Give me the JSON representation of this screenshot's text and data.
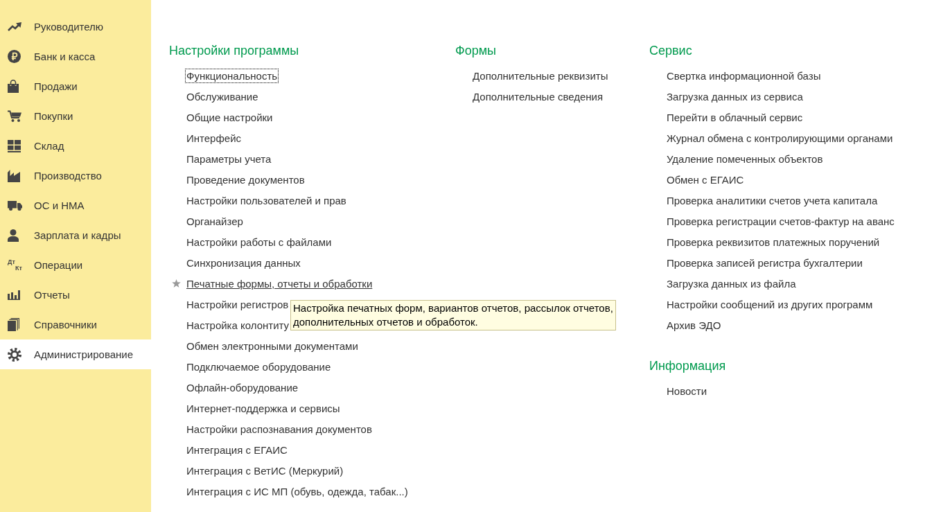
{
  "sidebar": {
    "items": [
      {
        "label": "Руководителю",
        "selected": false
      },
      {
        "label": "Банк и касса",
        "selected": false
      },
      {
        "label": "Продажи",
        "selected": false
      },
      {
        "label": "Покупки",
        "selected": false
      },
      {
        "label": "Склад",
        "selected": false
      },
      {
        "label": "Производство",
        "selected": false
      },
      {
        "label": "ОС и НМА",
        "selected": false
      },
      {
        "label": "Зарплата и кадры",
        "selected": false
      },
      {
        "label": "Операции",
        "selected": false,
        "icon_lines": [
          "Дт",
          "Кт"
        ]
      },
      {
        "label": "Отчеты",
        "selected": false
      },
      {
        "label": "Справочники",
        "selected": false
      },
      {
        "label": "Администрирование",
        "selected": true
      }
    ]
  },
  "columns": [
    {
      "groups": [
        {
          "title": "Настройки программы",
          "items": [
            {
              "label": "Функциональность",
              "focused": true,
              "hovered": false
            },
            {
              "label": "Обслуживание",
              "focused": false,
              "hovered": false
            },
            {
              "label": "Общие настройки",
              "focused": false,
              "hovered": false
            },
            {
              "label": "Интерфейс",
              "focused": false,
              "hovered": false
            },
            {
              "label": "Параметры учета",
              "focused": false,
              "hovered": false
            },
            {
              "label": "Проведение документов",
              "focused": false,
              "hovered": false
            },
            {
              "label": "Настройки пользователей и прав",
              "focused": false,
              "hovered": false
            },
            {
              "label": "Органайзер",
              "focused": false,
              "hovered": false
            },
            {
              "label": "Настройки работы с файлами",
              "focused": false,
              "hovered": false
            },
            {
              "label": "Синхронизация данных",
              "focused": false,
              "hovered": false
            },
            {
              "label": "Печатные формы, отчеты и обработки",
              "focused": false,
              "hovered": true
            },
            {
              "label": "Настройки регистров",
              "focused": false,
              "hovered": false
            },
            {
              "label": "Настройка колонтиту",
              "focused": false,
              "hovered": false
            },
            {
              "label": "Обмен электронными документами",
              "focused": false,
              "hovered": false
            },
            {
              "label": "Подключаемое оборудование",
              "focused": false,
              "hovered": false
            },
            {
              "label": "Офлайн-оборудование",
              "focused": false,
              "hovered": false
            },
            {
              "label": "Интернет-поддержка и сервисы",
              "focused": false,
              "hovered": false
            },
            {
              "label": "Настройки распознавания документов",
              "focused": false,
              "hovered": false
            },
            {
              "label": "Интеграция с ЕГАИС",
              "focused": false,
              "hovered": false
            },
            {
              "label": "Интеграция с ВетИС (Меркурий)",
              "focused": false,
              "hovered": false
            },
            {
              "label": "Интеграция с ИС МП (обувь, одежда, табак...)",
              "focused": false,
              "hovered": false
            }
          ]
        }
      ]
    },
    {
      "groups": [
        {
          "title": "Формы",
          "items": [
            {
              "label": "Дополнительные реквизиты",
              "focused": false,
              "hovered": false
            },
            {
              "label": "Дополнительные сведения",
              "focused": false,
              "hovered": false
            }
          ]
        }
      ]
    },
    {
      "groups": [
        {
          "title": "Сервис",
          "items": [
            {
              "label": "Свертка информационной базы",
              "focused": false,
              "hovered": false
            },
            {
              "label": "Загрузка данных из сервиса",
              "focused": false,
              "hovered": false
            },
            {
              "label": "Перейти в облачный сервис",
              "focused": false,
              "hovered": false
            },
            {
              "label": "Журнал обмена с контролирующими органами",
              "focused": false,
              "hovered": false
            },
            {
              "label": "Удаление помеченных объектов",
              "focused": false,
              "hovered": false
            },
            {
              "label": "Обмен с ЕГАИС",
              "focused": false,
              "hovered": false
            },
            {
              "label": "Проверка аналитики счетов учета капитала",
              "focused": false,
              "hovered": false
            },
            {
              "label": "Проверка регистрации счетов-фактур на аванс",
              "focused": false,
              "hovered": false
            },
            {
              "label": "Проверка реквизитов платежных поручений",
              "focused": false,
              "hovered": false
            },
            {
              "label": "Проверка записей регистра бухгалтерии",
              "focused": false,
              "hovered": false
            },
            {
              "label": "Загрузка данных из файла",
              "focused": false,
              "hovered": false
            },
            {
              "label": "Настройки сообщений из других программ",
              "focused": false,
              "hovered": false
            },
            {
              "label": "Архив ЭДО",
              "focused": false,
              "hovered": false
            }
          ]
        },
        {
          "title": "Информация",
          "items": [
            {
              "label": "Новости",
              "focused": false,
              "hovered": false
            }
          ]
        }
      ]
    }
  ],
  "tooltip": {
    "text": "Настройка печатных форм, вариантов отчетов, рассылок отчетов,\nдополнительных отчетов и обработок."
  }
}
